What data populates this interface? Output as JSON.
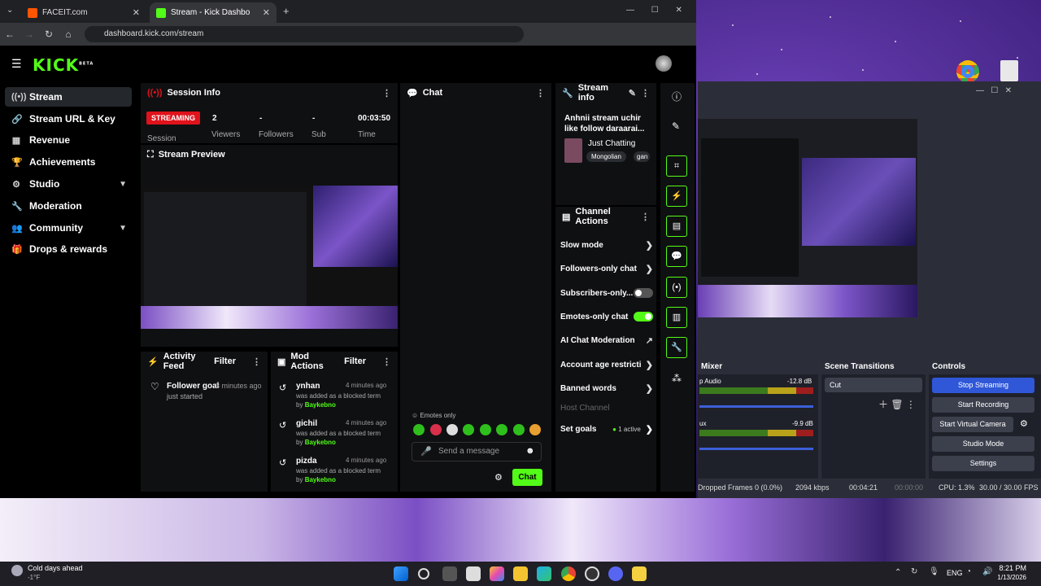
{
  "colors": {
    "kick_green": "#53fc18",
    "streaming_red": "#e0121b",
    "panel": "#0f1012"
  },
  "browser": {
    "tabs": [
      {
        "label": "FACEIT.com",
        "icon": "faceit-icon"
      },
      {
        "label": "Stream - Kick Dashbo",
        "icon": "kick-icon"
      }
    ],
    "url": "dashboard.kick.com/stream"
  },
  "kick": {
    "logo": "KICK",
    "logo_tag": "BETA",
    "sidebar": [
      {
        "label": "Stream",
        "icon": "stream-icon"
      },
      {
        "label": "Stream URL & Key",
        "icon": "link-icon"
      },
      {
        "label": "Revenue",
        "icon": "revenue-icon"
      },
      {
        "label": "Achievements",
        "icon": "trophy-icon"
      },
      {
        "label": "Studio",
        "icon": "studio-icon"
      },
      {
        "label": "Moderation",
        "icon": "wrench-icon"
      },
      {
        "label": "Community",
        "icon": "community-icon"
      },
      {
        "label": "Drops & rewards",
        "icon": "gift-icon"
      }
    ]
  },
  "session": {
    "title": "Session Info",
    "badge": "STREAMING",
    "session_label": "Session",
    "viewers_value": "2",
    "viewers_label": "Viewers",
    "followers_value": "-",
    "followers_label": "Followers",
    "sub_value": "-",
    "sub_label": "Sub",
    "time_value": "00:03:50",
    "time_label": "Time"
  },
  "preview": {
    "title": "Stream Preview"
  },
  "activity": {
    "title": "Activity Feed",
    "filter": "Filter",
    "items": [
      {
        "title": "Follower goal",
        "time": "3 minutes ago",
        "sub": "just started"
      }
    ]
  },
  "mod": {
    "title": "Mod Actions",
    "filter": "Filter",
    "items": [
      {
        "user": "ynhan",
        "time": "4 minutes ago",
        "line": "was added as a blocked term",
        "by": "by",
        "mod": "Baykebno"
      },
      {
        "user": "gichil",
        "time": "4 minutes ago",
        "line": "was added as a blocked term",
        "by": "by",
        "mod": "Baykebno"
      },
      {
        "user": "pizda",
        "time": "4 minutes ago",
        "line": "was added as a blocked term",
        "by": "by",
        "mod": "Baykebno"
      }
    ]
  },
  "chat": {
    "title": "Chat",
    "emotes_only": "Emotes only",
    "placeholder": "Send a message",
    "send": "Chat"
  },
  "stream_info": {
    "title": "Stream info",
    "stream_title": "Anhnii stream uchir like follow daraarai...",
    "category": "Just Chatting",
    "tags": [
      "Mongolian",
      "gan"
    ]
  },
  "channel_actions": {
    "title": "Channel Actions",
    "rows": [
      {
        "label": "Slow mode",
        "kind": "arrow"
      },
      {
        "label": "Followers-only chat",
        "kind": "arrow"
      },
      {
        "label": "Subscribers-only...",
        "kind": "toggle-off"
      },
      {
        "label": "Emotes-only chat",
        "kind": "toggle-on"
      },
      {
        "label": "AI Chat Moderation",
        "kind": "external"
      },
      {
        "label": "Account age restricti",
        "kind": "arrow"
      },
      {
        "label": "Banned words",
        "kind": "arrow"
      },
      {
        "label": "Host Channel",
        "kind": "disabled"
      },
      {
        "label": "Set goals",
        "kind": "arrow"
      }
    ],
    "goals_badge": "1 active"
  },
  "obs": {
    "mixer_title": "Mixer",
    "transitions_title": "Scene Transitions",
    "controls_title": "Controls",
    "mic_label": "p Audio",
    "mic_db": "-12.8 dB",
    "aux_label": "ux",
    "aux_db": "-9.9 dB",
    "transition": "Cut",
    "buttons": [
      "Stop Streaming",
      "Start Recording",
      "Start Virtual Camera",
      "Studio Mode",
      "Settings"
    ],
    "status": {
      "dropped": "Dropped Frames 0 (0.0%)",
      "kbps": "2094 kbps",
      "live": "00:04:21",
      "rec": "00:00:00",
      "cpu": "CPU: 1.3%",
      "fps": "30.00 / 30.00 FPS"
    }
  },
  "taskbar": {
    "weather_title": "Cold days ahead",
    "weather_temp": "-1°F",
    "lang": "ENG",
    "time": "8:21 PM",
    "date": "1/13/2026"
  }
}
